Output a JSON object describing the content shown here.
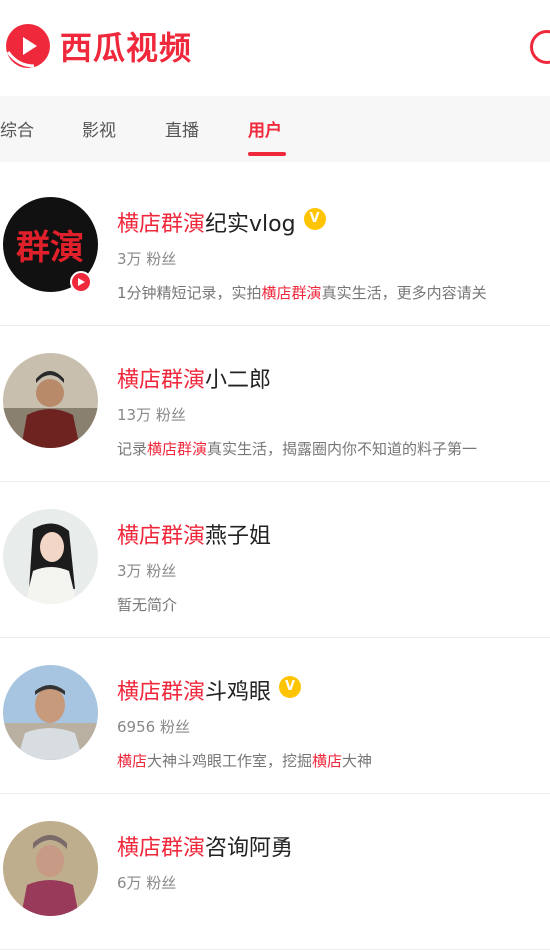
{
  "app": {
    "name": "西瓜视频"
  },
  "colors": {
    "accent": "#f0283c",
    "verified": "#ffc400"
  },
  "tabs": [
    {
      "label": "综合",
      "active": false
    },
    {
      "label": "影视",
      "active": false
    },
    {
      "label": "直播",
      "active": false
    },
    {
      "label": "用户",
      "active": true
    }
  ],
  "users": [
    {
      "name_highlight": "横店群演",
      "name_rest": "纪实vlog",
      "verified": true,
      "live": true,
      "avatar_text": "群演",
      "fans": "3万 粉丝",
      "desc_parts": [
        "1分钟精短记录，实拍",
        "横店群演",
        "真实生活，更多内容请关"
      ]
    },
    {
      "name_highlight": "横店群演",
      "name_rest": "小二郎",
      "verified": false,
      "live": false,
      "fans": "13万 粉丝",
      "desc_parts": [
        "记录",
        "横店群演",
        "真实生活，揭露圈内你不知道的料子第一"
      ]
    },
    {
      "name_highlight": "横店群演",
      "name_rest": "燕子姐",
      "verified": false,
      "live": false,
      "fans": "3万 粉丝",
      "desc_parts": [
        "暂无简介"
      ]
    },
    {
      "name_highlight": "横店群演",
      "name_rest": "斗鸡眼",
      "verified": true,
      "live": false,
      "fans": "6956 粉丝",
      "desc_parts": [
        "",
        "横店",
        "大神斗鸡眼工作室，挖掘",
        "横店",
        "大神"
      ]
    },
    {
      "name_highlight": "横店群演",
      "name_rest": "咨询阿勇",
      "verified": false,
      "live": false,
      "fans": "6万 粉丝",
      "desc_parts": []
    }
  ]
}
